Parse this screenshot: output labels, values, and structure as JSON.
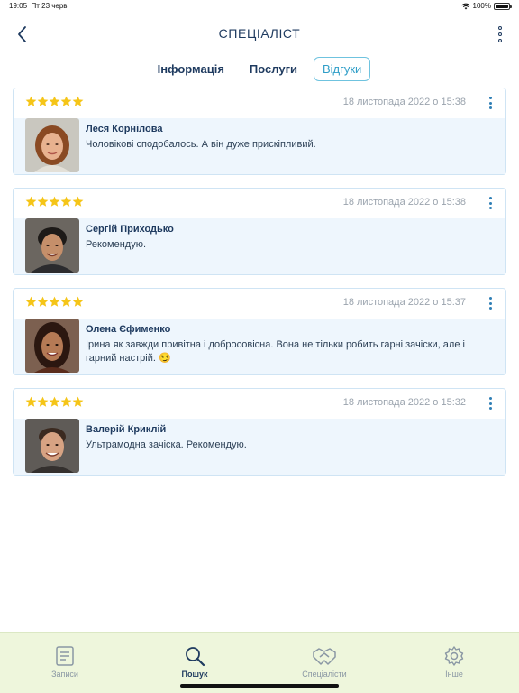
{
  "status_bar": {
    "time": "19:05",
    "date": "Пт 23 черв.",
    "battery": "100%",
    "battery_level": 1.0
  },
  "header": {
    "title": "СПЕЦІАЛІСТ",
    "back_icon": "chevron-left-icon",
    "menu_icon": "more-vertical-icon"
  },
  "tabs": [
    {
      "label": "Інформація",
      "active": false
    },
    {
      "label": "Послуги",
      "active": false
    },
    {
      "label": "Відгуки",
      "active": true
    }
  ],
  "reviews": [
    {
      "rating": 5,
      "date": "18 листопада 2022 о 15:38",
      "name": "Леся Корнілова",
      "text": "Чоловікові сподобалось. А він дуже прискіпливий."
    },
    {
      "rating": 5,
      "date": "18 листопада 2022 о 15:38",
      "name": "Сергій Приходько",
      "text": "Рекомендую."
    },
    {
      "rating": 5,
      "date": "18 листопада 2022 о 15:37",
      "name": "Олена Єфименко",
      "text": "Ірина як завжди привітна і добросовісна. Вона не тільки робить гарні зачіски, але і гарний настрій. 😏"
    },
    {
      "rating": 5,
      "date": "18 листопада 2022 о 15:32",
      "name": "Валерій Криклій",
      "text": "Ультрамодна зачіска. Рекомендую."
    }
  ],
  "bottom_nav": [
    {
      "label": "Записи",
      "icon": "clipboard-icon",
      "active": false
    },
    {
      "label": "Пошук",
      "icon": "search-icon",
      "active": true
    },
    {
      "label": "Спеціалісти",
      "icon": "handshake-icon",
      "active": false
    },
    {
      "label": "Інше",
      "icon": "gear-icon",
      "active": false
    }
  ],
  "colors": {
    "accent": "#2f9ec8",
    "text": "#1e3a5f",
    "star": "#f5c518",
    "card_bg": "#eef6fd",
    "nav_bg": "#eef6dc"
  }
}
